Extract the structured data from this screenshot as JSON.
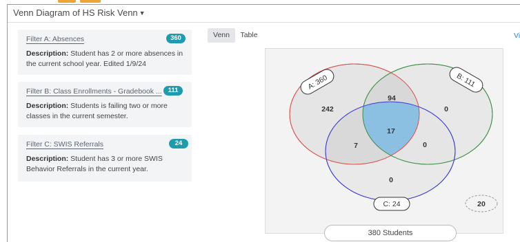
{
  "header": {
    "title": "Venn Diagram of  HS Risk Venn",
    "caret_icon": "caret-down-icon"
  },
  "colors": {
    "badge": "#1f9bb0",
    "circle_a": "#d9534f",
    "circle_b": "#3d8f48",
    "circle_c": "#3b3bd6",
    "center": "#8cc0e2",
    "link": "#2a86c5",
    "top_chip": "#f0a637"
  },
  "filters": [
    {
      "name": "Filter A: Absences",
      "count": "360",
      "desc_label": "Description:",
      "desc_text": " Student has 2 or more absences in the current school year. Edited 1/9/24"
    },
    {
      "name": "Filter B: Class Enrollments - Gradebook ...",
      "count": "111",
      "desc_label": "Description:",
      "desc_text": " Students is failing two or more classes in the current semester."
    },
    {
      "name": "Filter C: SWIS Referrals",
      "count": "24",
      "desc_label": "Description:",
      "desc_text": " Student has 3 or more SWIS Behavior Referrals in the current year."
    }
  ],
  "tabs": [
    {
      "label": "Venn",
      "active": true
    },
    {
      "label": "Table",
      "active": false
    }
  ],
  "view_link": "Vi",
  "venn": {
    "label_a": "A: 360",
    "label_b": "B: 111",
    "label_c": "C: 24",
    "region_a_only": "242",
    "region_b_only": "0",
    "region_c_only": "0",
    "region_ab": "94",
    "region_ac": "7",
    "region_bc": "0",
    "region_abc": "17",
    "outside": "20"
  },
  "total_students": "380 Students"
}
